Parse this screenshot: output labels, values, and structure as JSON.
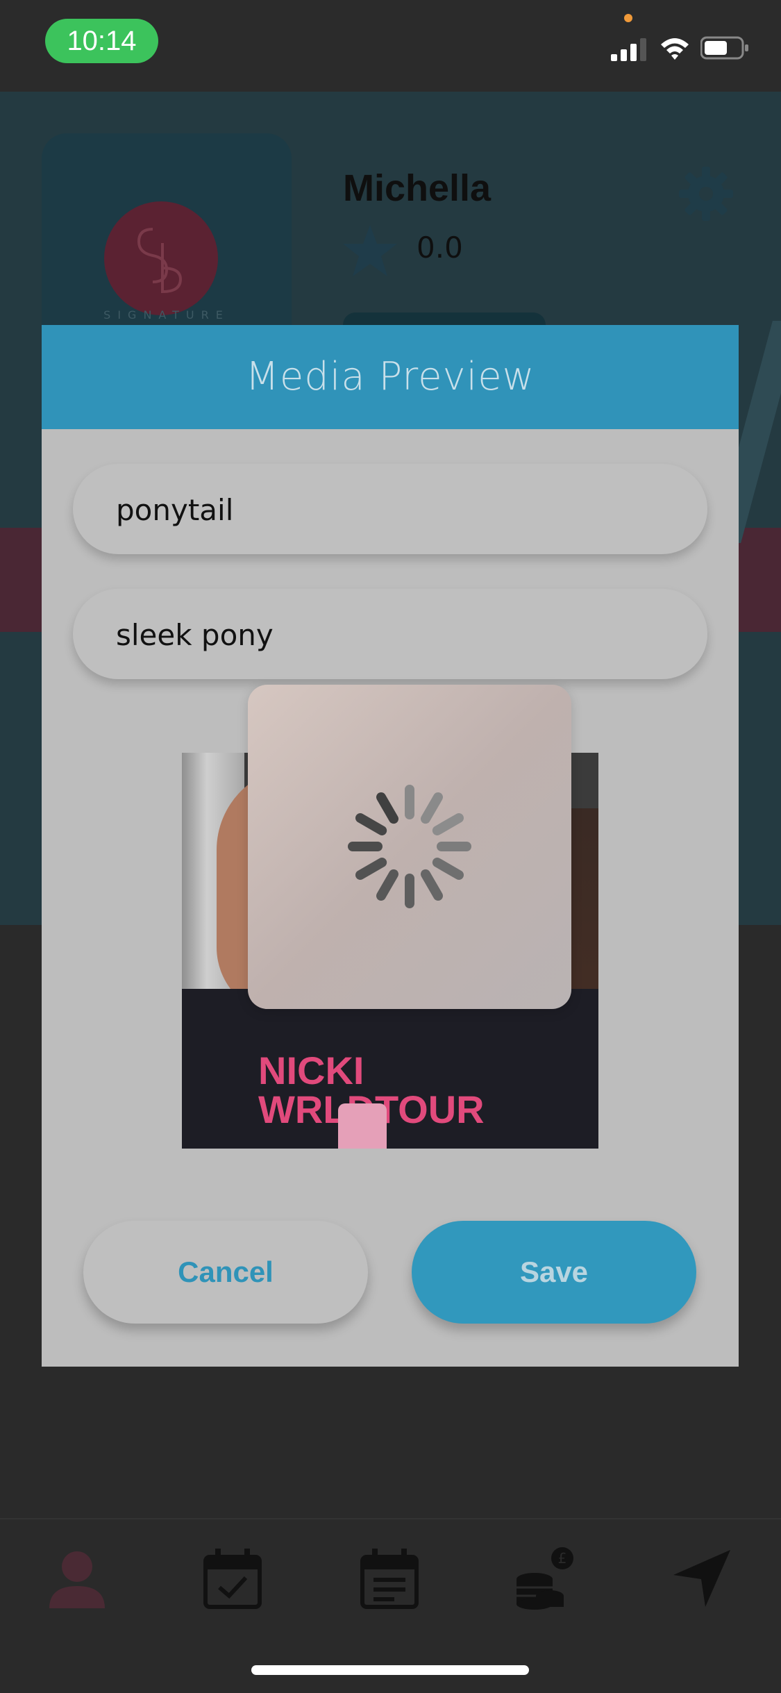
{
  "status_bar": {
    "time": "10:14",
    "icons": [
      "signal-icon",
      "wifi-icon",
      "battery-icon"
    ]
  },
  "profile": {
    "name": "Michella",
    "rating": "0.0",
    "logo_text": "SIGNATURE"
  },
  "modal": {
    "title": "Media Preview",
    "field1_value": "ponytail",
    "field2_value": "sleek pony",
    "media_print_text": [
      "NICKI",
      "WRLDTOUR"
    ],
    "cancel_label": "Cancel",
    "save_label": "Save"
  },
  "tab_bar": {
    "items": [
      "profile-icon",
      "calendar-check-icon",
      "calendar-icon",
      "coins-icon",
      "send-icon"
    ]
  },
  "colors": {
    "accent": "#3093b9",
    "status_green": "#3cc35c",
    "modal_bg": "#bdbdbd"
  }
}
